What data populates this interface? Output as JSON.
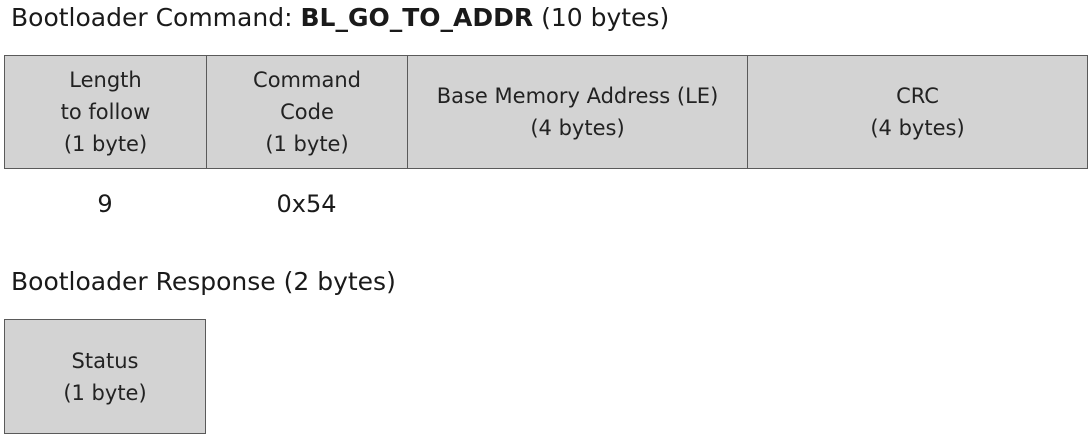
{
  "command": {
    "title_prefix": "Bootloader Command: ",
    "title_name": "BL_GO_TO_ADDR",
    "title_suffix": " (10 bytes)",
    "fields": [
      {
        "lines": [
          "Length",
          "to follow",
          "(1 byte)"
        ],
        "value": "9"
      },
      {
        "lines": [
          "Command",
          "Code",
          "(1 byte)"
        ],
        "value": "0x54"
      },
      {
        "lines": [
          "Base Memory Address (LE)",
          "(4 bytes)"
        ],
        "value": ""
      },
      {
        "lines": [
          "CRC",
          "(4 bytes)"
        ],
        "value": ""
      }
    ]
  },
  "response": {
    "title": "Bootloader Response (2 bytes)",
    "fields": [
      {
        "lines": [
          "Status",
          "(1 byte)"
        ]
      }
    ]
  }
}
